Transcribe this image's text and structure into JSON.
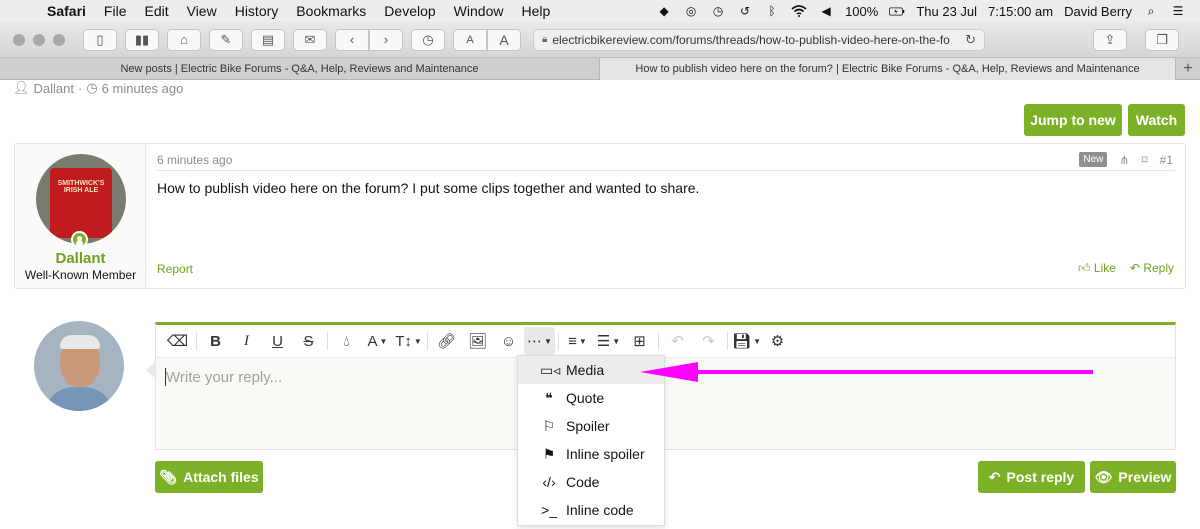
{
  "menubar": {
    "app": "Safari",
    "items": [
      "File",
      "Edit",
      "View",
      "History",
      "Bookmarks",
      "Develop",
      "Window",
      "Help"
    ],
    "battery": "100%",
    "date": "Thu 23 Jul",
    "time": "7:15:00 am",
    "user": "David Berry"
  },
  "browser": {
    "url": "electricbikereview.com/forums/threads/how-to-publish-video-here-on-the-fo",
    "tabs": [
      {
        "title": "New posts | Electric Bike Forums - Q&A, Help, Reviews and Maintenance"
      },
      {
        "title": "How to publish video here on the forum? | Electric Bike Forums - Q&A, Help, Reviews and Maintenance"
      }
    ]
  },
  "thread": {
    "author": "Dallant",
    "posted": "6 minutes ago",
    "jump_label": "Jump to new",
    "watch_label": "Watch"
  },
  "post": {
    "time": "6 minutes ago",
    "badge": "New",
    "number": "#1",
    "body": "How to publish video here on the forum? I put some clips together and wanted to share.",
    "username": "Dallant",
    "user_title": "Well-Known Member",
    "avatar_text": "SMITHWICK'S IRISH ALE",
    "report": "Report",
    "like": "Like",
    "reply": "Reply"
  },
  "editor": {
    "placeholder": "Write your reply...",
    "dropdown": [
      {
        "label": "Media",
        "icon": "video-icon"
      },
      {
        "label": "Quote",
        "icon": "quote-icon"
      },
      {
        "label": "Spoiler",
        "icon": "flag-icon"
      },
      {
        "label": "Inline spoiler",
        "icon": "checkered-flag-icon"
      },
      {
        "label": "Code",
        "icon": "code-icon"
      },
      {
        "label": "Inline code",
        "icon": "terminal-icon"
      }
    ],
    "attach_label": "Attach files",
    "post_label": "Post reply",
    "preview_label": "Preview"
  },
  "colors": {
    "accent": "#7cb127",
    "annotation_arrow": "#ff00ff"
  }
}
